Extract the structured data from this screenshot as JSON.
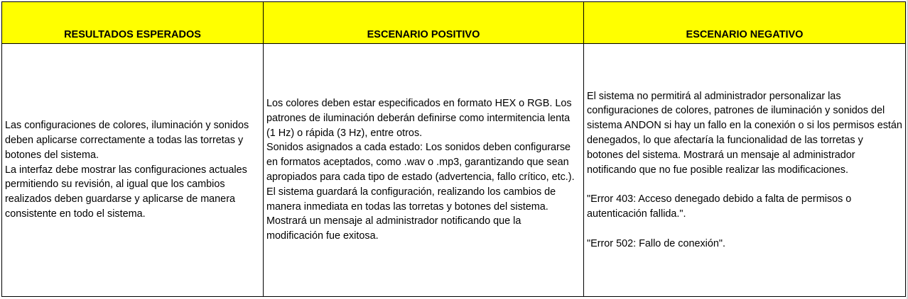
{
  "table": {
    "headers": {
      "col1": "RESULTADOS ESPERADOS",
      "col2": "ESCENARIO POSITIVO",
      "col3": "ESCENARIO NEGATIVO"
    },
    "row": {
      "col1": [
        "Las configuraciones de colores, iluminación y sonidos deben aplicarse correctamente a todas las torretas y botones del sistema.",
        "La interfaz debe mostrar las configuraciones actuales permitiendo su revisión, al igual que los cambios realizados deben guardarse y aplicarse de manera consistente en todo el sistema."
      ],
      "col2": [
        "Los colores deben estar especificados en formato HEX o RGB. Los patrones de iluminación deberán definirse como intermitencia lenta (1 Hz) o rápida (3 Hz), entre otros.",
        "Sonidos asignados a cada estado: Los sonidos deben configurarse en formatos aceptados, como .wav o .mp3, garantizando que sean apropiados para cada tipo de estado (advertencia, fallo crítico, etc.). El sistema guardará la configuración, realizando los cambios de manera inmediata en todas las torretas y botones del sistema. Mostrará un mensaje al administrador notificando que la modificación fue exitosa."
      ],
      "col3": {
        "paragraph": "El sistema no permitirá al administrador personalizar las configuraciones de colores, patrones de iluminación y sonidos del sistema ANDON si hay un fallo en la conexión o si los permisos están denegados, lo que afectaría la funcionalidad de las torretas y botones del sistema. Mostrará un mensaje al administrador notificando que no fue posible realizar las modificaciones.",
        "error_403": "\"Error 403: Acceso denegado debido a falta de permisos o autenticación fallida.\".",
        "error_502": "\"Error 502: Fallo de conexión\"."
      }
    },
    "colors": {
      "header_fill": "#ffff00",
      "border": "#000000",
      "text": "#000000"
    }
  }
}
